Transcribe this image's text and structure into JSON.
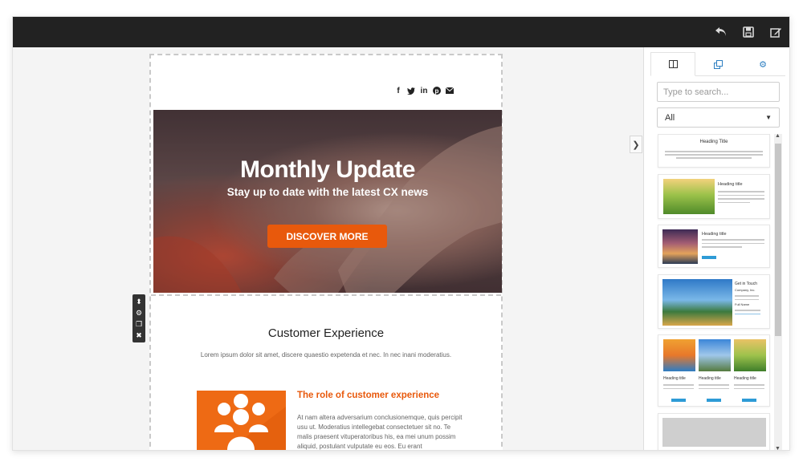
{
  "toolbar": {
    "icons": [
      "undo-icon",
      "save-icon",
      "edit-icon"
    ]
  },
  "email": {
    "social_icons": [
      "f",
      "t",
      "in",
      "p",
      "✉"
    ],
    "hero": {
      "title": "Monthly Update",
      "subtitle": "Stay up to date with the latest CX news",
      "button_label": "DISCOVER MORE"
    },
    "section": {
      "title": "Customer Experience",
      "text": "Lorem ipsum dolor sit amet, discere quaestio expetenda et nec. In nec inani moderatius."
    },
    "feature": {
      "title": "The role of customer experience",
      "text": "At nam altera adversarium conclusionemque, quis percipit usu ut. Moderatius intellegebat consectetuer sit no. Te malis praesent vituperatoribus his, ea mei unum possim aliquid, postulant vulputate eu eos. Eu erant"
    }
  },
  "panel": {
    "search": {
      "placeholder": "Type to search..."
    },
    "filter": {
      "selected": "All"
    },
    "blocks": [
      {
        "heading": "Heading Title"
      },
      {
        "heading": "Heading title"
      },
      {
        "heading": "Heading title",
        "button": "Read more"
      },
      {
        "heading": "Get in Touch",
        "company": "Company, Inc.",
        "contact_label": "Full Name"
      },
      {
        "headings": [
          "Heading title",
          "Heading title",
          "Heading title"
        ]
      }
    ]
  },
  "colors": {
    "accent": "#e8590c",
    "topbar": "#222222",
    "link_blue": "#2e9bd6"
  }
}
